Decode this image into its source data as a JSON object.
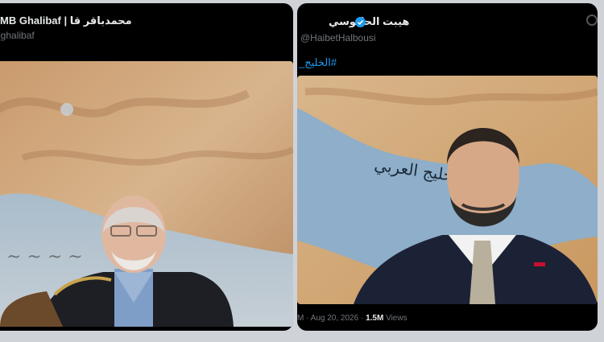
{
  "left_post": {
    "display_name": "MB Ghalibaf | محمدباقر قا",
    "handle": "_ghalibaf"
  },
  "right_post": {
    "display_name": "هيبت الحلبوسي",
    "handle": "@HaibetHalbousi",
    "hashtag": "#الخليج_",
    "timestamp": "M · Aug 20, 2026",
    "views_count": "1.5M",
    "views_label": "Views",
    "map_caption": "الخليج العربي"
  },
  "colors": {
    "card_bg": "#000000",
    "link_blue": "#1d9bf0",
    "verified_blue": "#1d9bf0",
    "sea_blue": "#8eaec9",
    "land_tan": "#d9b68c"
  },
  "icons": [
    "verified-badge-icon",
    "more-options-icon"
  ]
}
